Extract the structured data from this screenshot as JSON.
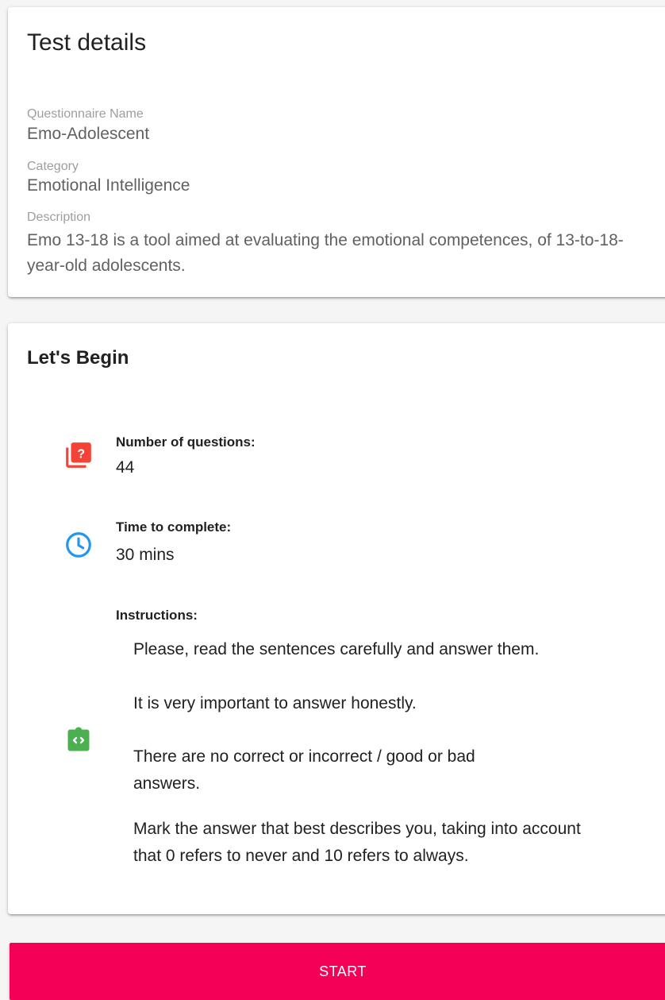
{
  "details": {
    "title": "Test details",
    "name_label": "Questionnaire Name",
    "name_value": "Emo-Adolescent",
    "category_label": "Category",
    "category_value": "Emotional Intelligence",
    "description_label": "Description",
    "description_value": "Emo 13-18 is a tool aimed at evaluating the emotional competences, of 13-to-18-year-old adolescents."
  },
  "begin": {
    "title": "Let's Begin",
    "questions_label": "Number of questions:",
    "questions_value": "44",
    "time_label": "Time to complete:",
    "time_value": "30 mins",
    "instructions_label": "Instructions:",
    "instructions": [
      "Please, read the sentences carefully and answer them.",
      "It is very important to answer honestly.",
      "There are no correct or incorrect / good or bad answers.",
      "Mark the answer that best describes you, taking into account that 0 refers to never and 10 refers to always."
    ]
  },
  "start_label": "START",
  "colors": {
    "accent": "#f50057",
    "questions_icon": "#f44336",
    "time_icon": "#2196f3",
    "instructions_icon": "#4caf50"
  },
  "icons": {
    "questions": "question-library-icon",
    "time": "clock-icon",
    "instructions": "assignment-code-icon"
  }
}
